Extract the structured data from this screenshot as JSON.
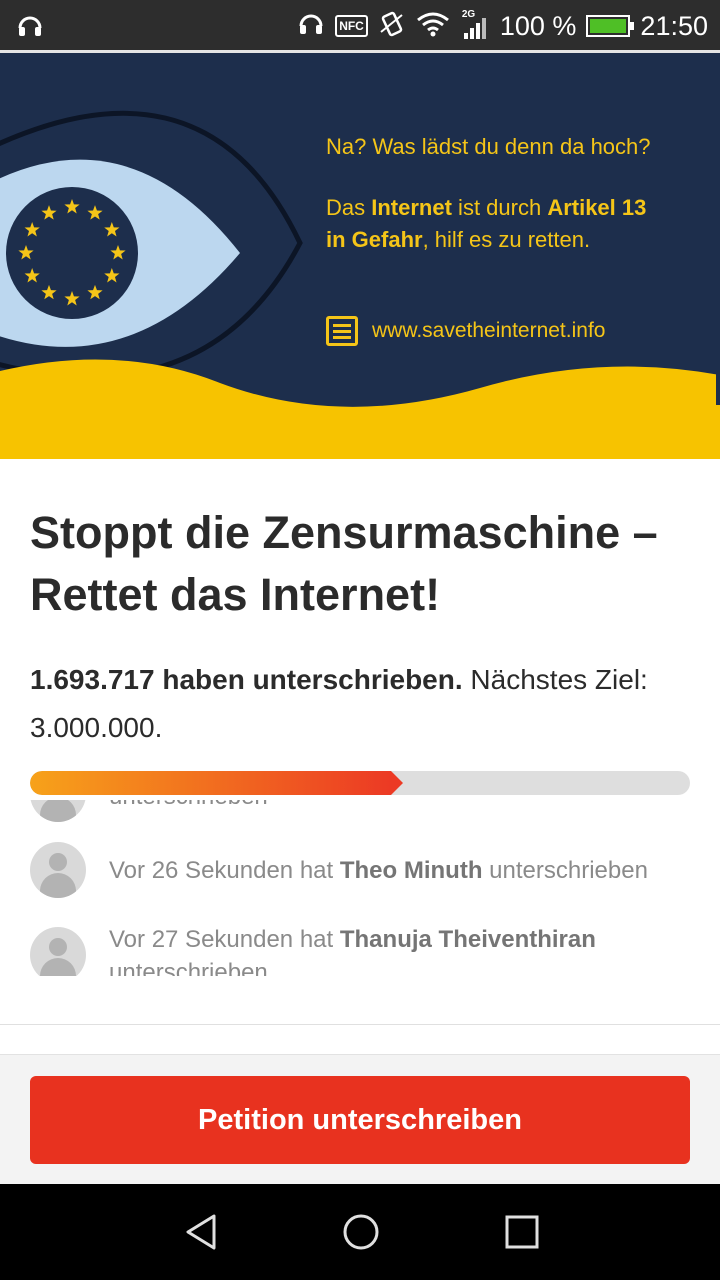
{
  "status_bar": {
    "network": "2G",
    "nfc": "NFC",
    "battery": "100 %",
    "time": "21:50",
    "icons": [
      "headset-icon",
      "nfc-icon",
      "vibrate-icon",
      "wifi-icon",
      "signal-icon",
      "battery-icon"
    ]
  },
  "hero": {
    "question": "Na? Was lädst du denn da hoch?",
    "message_parts": {
      "p1": "Das ",
      "b1": "Internet",
      "p2": " ist durch ",
      "b2": "Artikel 13",
      "p3": " ",
      "b3": "in Gefahr",
      "p4": ", hilf es zu retten."
    },
    "url": "www.savetheinternet.info",
    "colors": {
      "navy": "#1d2e4c",
      "yellow": "#f5c518",
      "eye": "#bcd7ef"
    }
  },
  "petition": {
    "title": "Stoppt die Zensurmaschine – Rettet das Internet!",
    "signatures_bold": "1.693.717 haben unterschrieben.",
    "next_goal": " Nächstes Ziel: 3.000.000.",
    "progress": 0.565
  },
  "feed": {
    "items": [
      {
        "prefix": "",
        "name": "",
        "suffix": "unterschrieben"
      },
      {
        "prefix": "Vor 26 Sekunden hat ",
        "name": "Theo Minuth",
        "suffix": " unterschrieben"
      },
      {
        "prefix": "Vor 27 Sekunden hat ",
        "name": "Thanuja Theiventhiran",
        "suffix": " unterschrieben"
      }
    ]
  },
  "cta": {
    "label": "Petition unterschreiben",
    "color": "#e8321f"
  },
  "nav": {
    "icons": [
      "back-icon",
      "home-icon",
      "recents-icon"
    ]
  }
}
